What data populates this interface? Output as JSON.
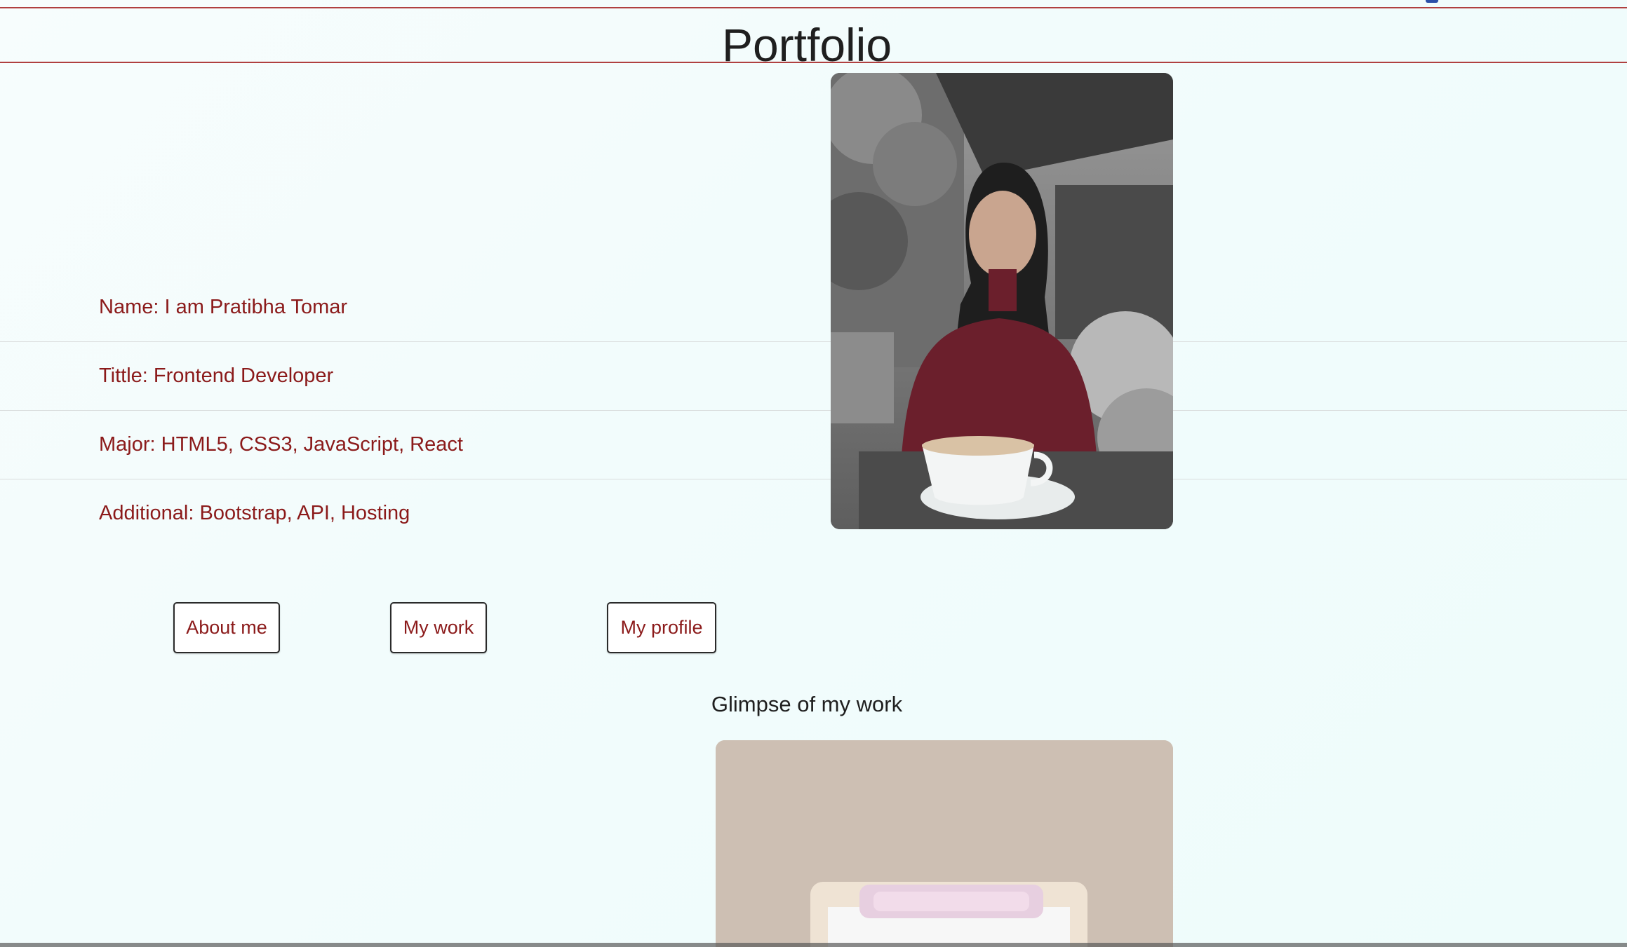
{
  "header": {
    "title": "Portfolio"
  },
  "info": {
    "name": "Name: I am Pratibha Tomar",
    "title": "Tittle: Frontend Developer",
    "major": "Major: HTML5, CSS3, JavaScript, React",
    "additional": "Additional: Bootstrap, API, Hosting"
  },
  "buttons": {
    "about": "About me",
    "work": "My work",
    "profile": "My profile"
  },
  "work_section": {
    "heading": "Glimpse of my work"
  },
  "colors": {
    "accent": "#8b1a1a",
    "rule": "#b04040",
    "background": "#f2fcfc"
  }
}
